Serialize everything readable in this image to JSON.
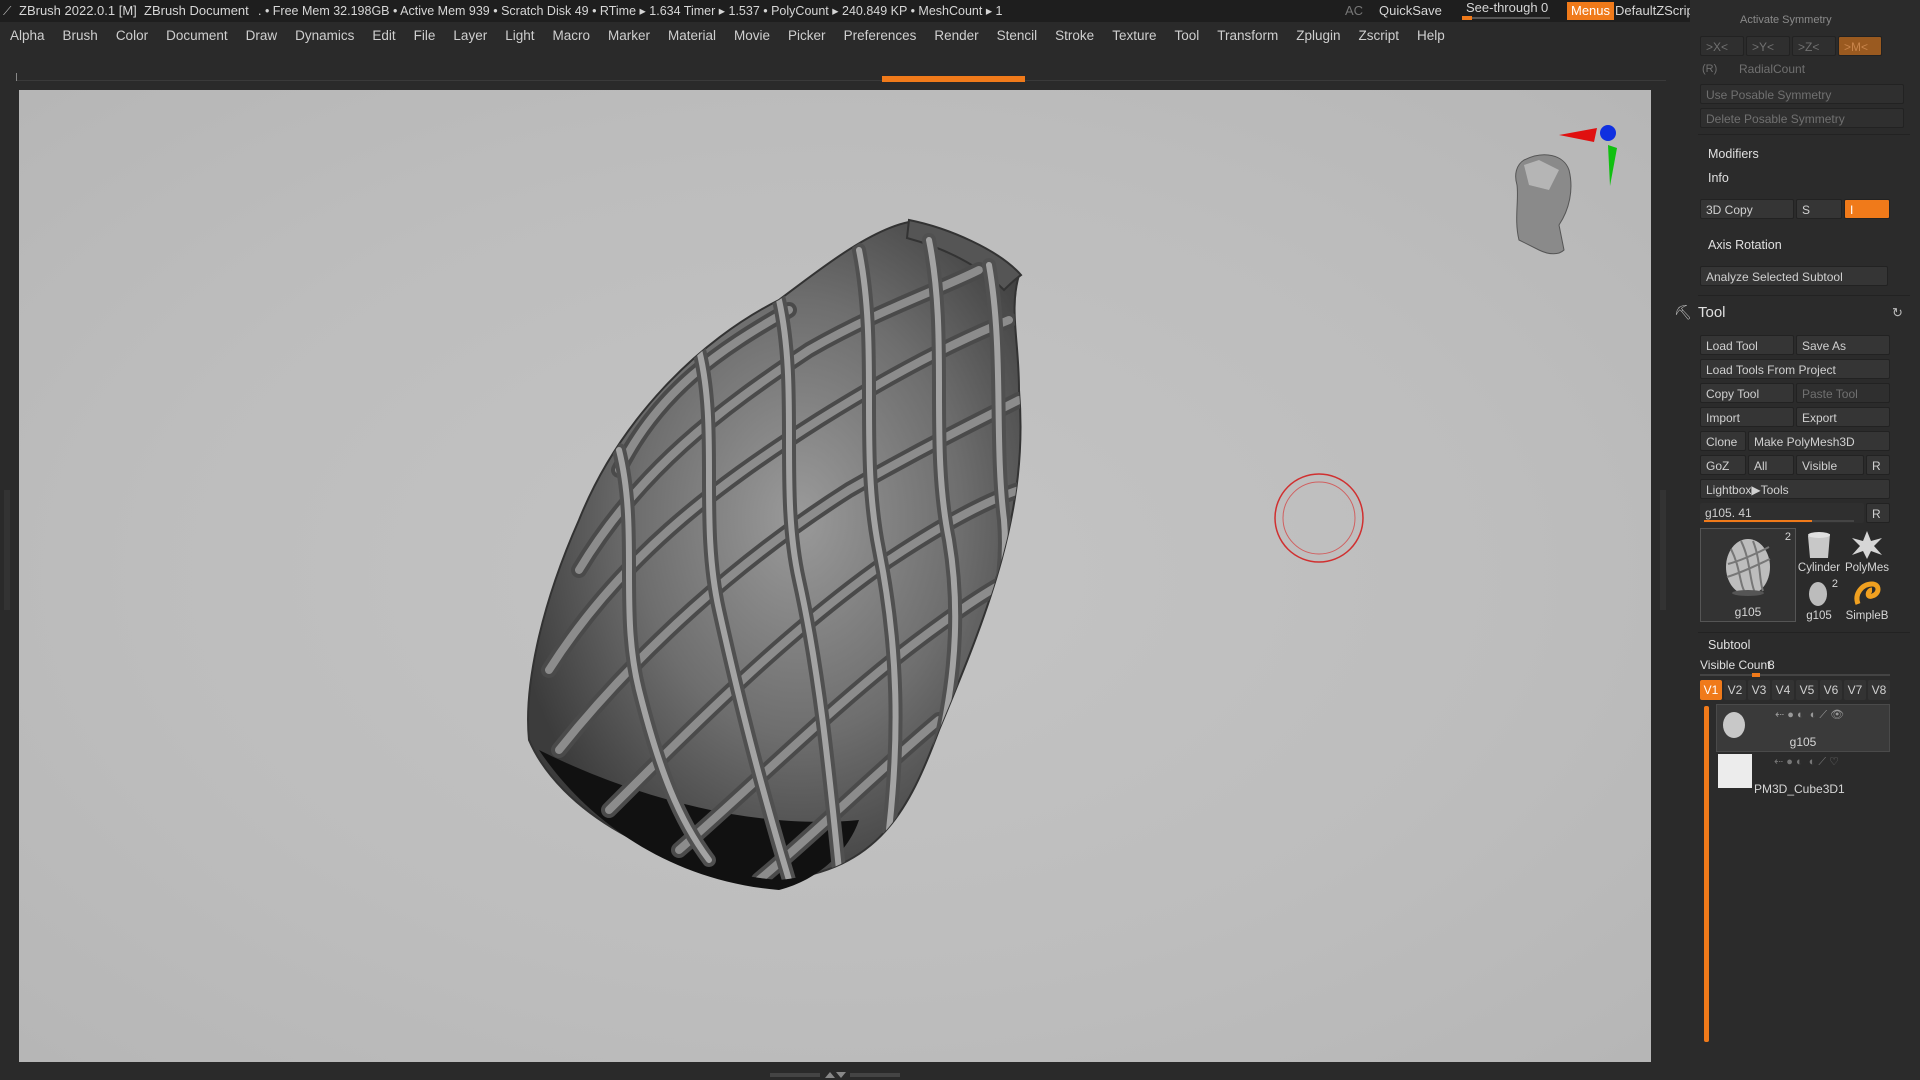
{
  "titlebar": {
    "app": "ZBrush 2022.0.1 [M]",
    "document": "ZBrush Document",
    "stats": ". • Free Mem 32.198GB • Active Mem 939 • Scratch Disk 49 • RTime ▸ 1.634 Timer ▸ 1.537 • PolyCount ▸ 240.849 KP • MeshCount ▸ 1",
    "ac": "AC",
    "quicksave": "QuickSave",
    "seethrough_label": "See-through",
    "seethrough_value": "0",
    "seethrough_level": 0,
    "menus": "Menus",
    "script": "DefaultZScript",
    "window_icons": [
      "layout-icon-1",
      "layout-icon-2",
      "layout-icon-3",
      "layout-icon-4"
    ],
    "window_controls": [
      "minimize-icon",
      "maximize-icon",
      "close-icon"
    ]
  },
  "menubar": {
    "items": [
      "Alpha",
      "Brush",
      "Color",
      "Document",
      "Draw",
      "Dynamics",
      "Edit",
      "File",
      "Layer",
      "Light",
      "Macro",
      "Marker",
      "Material",
      "Movie",
      "Picker",
      "Preferences",
      "Render",
      "Stencil",
      "Stroke",
      "Texture",
      "Tool",
      "Transform",
      "Zplugin",
      "Zscript",
      "Help"
    ]
  },
  "tray": {
    "cut_header": "Activate Symmetry",
    "sym_buttons": [
      ">X<",
      ">Y<",
      ">Z<",
      ">M<"
    ],
    "radial_r": "(R)",
    "radial_label": "RadialCount",
    "use_posable": "Use Posable Symmetry",
    "delete_posable": "Delete Posable Symmetry",
    "modifiers": "Modifiers",
    "info": "Info",
    "copy3d": "3D Copy",
    "s_label": "S",
    "i_value": "I",
    "axis_rotation": "Axis Rotation",
    "analyze": "Analyze Selected Subtool",
    "tool_title": "Tool",
    "load_tool": "Load Tool",
    "save_as": "Save As",
    "load_from_project": "Load Tools From Project",
    "copy_tool": "Copy Tool",
    "paste_tool": "Paste Tool",
    "import": "Import",
    "export": "Export",
    "clone": "Clone",
    "make_polymesh": "Make PolyMesh3D",
    "goz": "GoZ",
    "all": "All",
    "visible": "Visible",
    "r": "R",
    "lightbox_tools": "Lightbox▶Tools",
    "current_tool": "g105. 41",
    "tool_slider_level": 0.72,
    "thumbs": {
      "main_count": "2",
      "main_name": "g105",
      "cylinder": "Cylinder",
      "polymesh": "PolyMes",
      "small_count": "2",
      "small_name": "g105",
      "simple": "SimpleB"
    },
    "subtool_title": "Subtool",
    "visible_count_label": "Visible Count",
    "visible_count": "8",
    "vtabs": [
      "V1",
      "V2",
      "V3",
      "V4",
      "V5",
      "V6",
      "V7",
      "V8"
    ],
    "subtools": [
      {
        "name": "g105"
      },
      {
        "name": "PM3D_Cube3D1"
      }
    ]
  },
  "colors": {
    "accent": "#f07a1a",
    "canvas": "#bfbfbf",
    "panel": "#2b2b2b"
  }
}
